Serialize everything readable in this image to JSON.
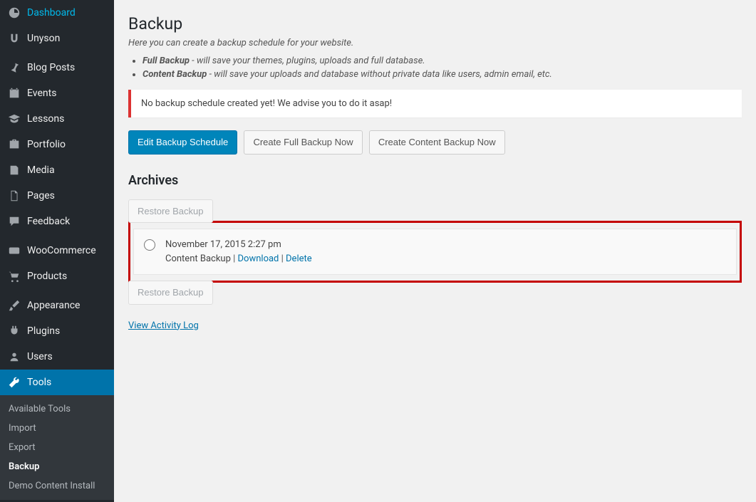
{
  "sidebar": {
    "items": [
      {
        "label": "Dashboard"
      },
      {
        "label": "Unyson"
      },
      {
        "label": "Blog Posts"
      },
      {
        "label": "Events"
      },
      {
        "label": "Lessons"
      },
      {
        "label": "Portfolio"
      },
      {
        "label": "Media"
      },
      {
        "label": "Pages"
      },
      {
        "label": "Feedback"
      },
      {
        "label": "WooCommerce"
      },
      {
        "label": "Products"
      },
      {
        "label": "Appearance"
      },
      {
        "label": "Plugins"
      },
      {
        "label": "Users"
      },
      {
        "label": "Tools"
      }
    ],
    "sub": [
      {
        "label": "Available Tools"
      },
      {
        "label": "Import"
      },
      {
        "label": "Export"
      },
      {
        "label": "Backup"
      },
      {
        "label": "Demo Content Install"
      }
    ]
  },
  "page": {
    "title": "Backup",
    "subtitle": "Here you can create a backup schedule for your website.",
    "bullets": {
      "full_label": "Full Backup",
      "full_desc": " - will save your themes, plugins, uploads and full database.",
      "content_label": "Content Backup",
      "content_desc": " - will save your uploads and database without private data like users, admin email, etc."
    },
    "notice": "No backup schedule created yet! We advise you to do it asap!",
    "buttons": {
      "edit": "Edit Backup Schedule",
      "full": "Create Full Backup Now",
      "content": "Create Content Backup Now"
    },
    "archives_title": "Archives",
    "restore_label": "Restore Backup",
    "archive": {
      "date": "November 17, 2015 2:27 pm",
      "type": "Content Backup",
      "download": "Download",
      "delete": "Delete",
      "sep": " | "
    },
    "activity_log": "View Activity Log"
  }
}
